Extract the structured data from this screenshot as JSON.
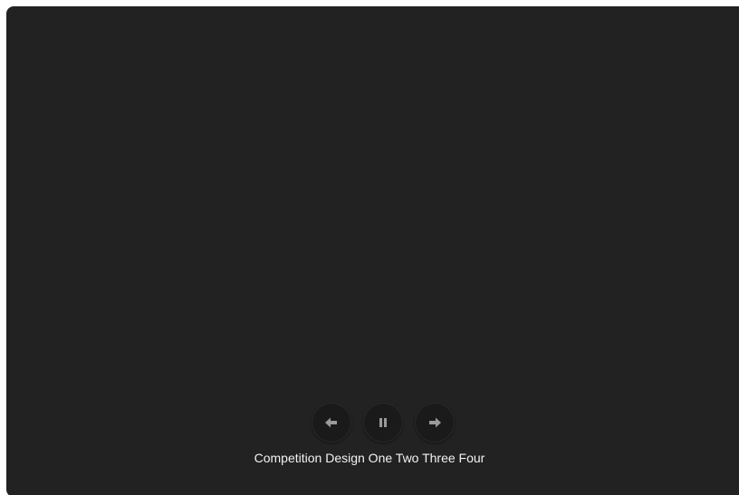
{
  "slideshow": {
    "caption": "Competition Design One Two Three Four",
    "controls": {
      "previous": {
        "icon": "arrow-left-icon"
      },
      "pause": {
        "icon": "pause-icon"
      },
      "next": {
        "icon": "arrow-right-icon"
      }
    },
    "colors": {
      "background": "#222222",
      "button": "#1a1a1a",
      "icon": "#9a9a9a",
      "caption": "#f2f2f2"
    }
  }
}
